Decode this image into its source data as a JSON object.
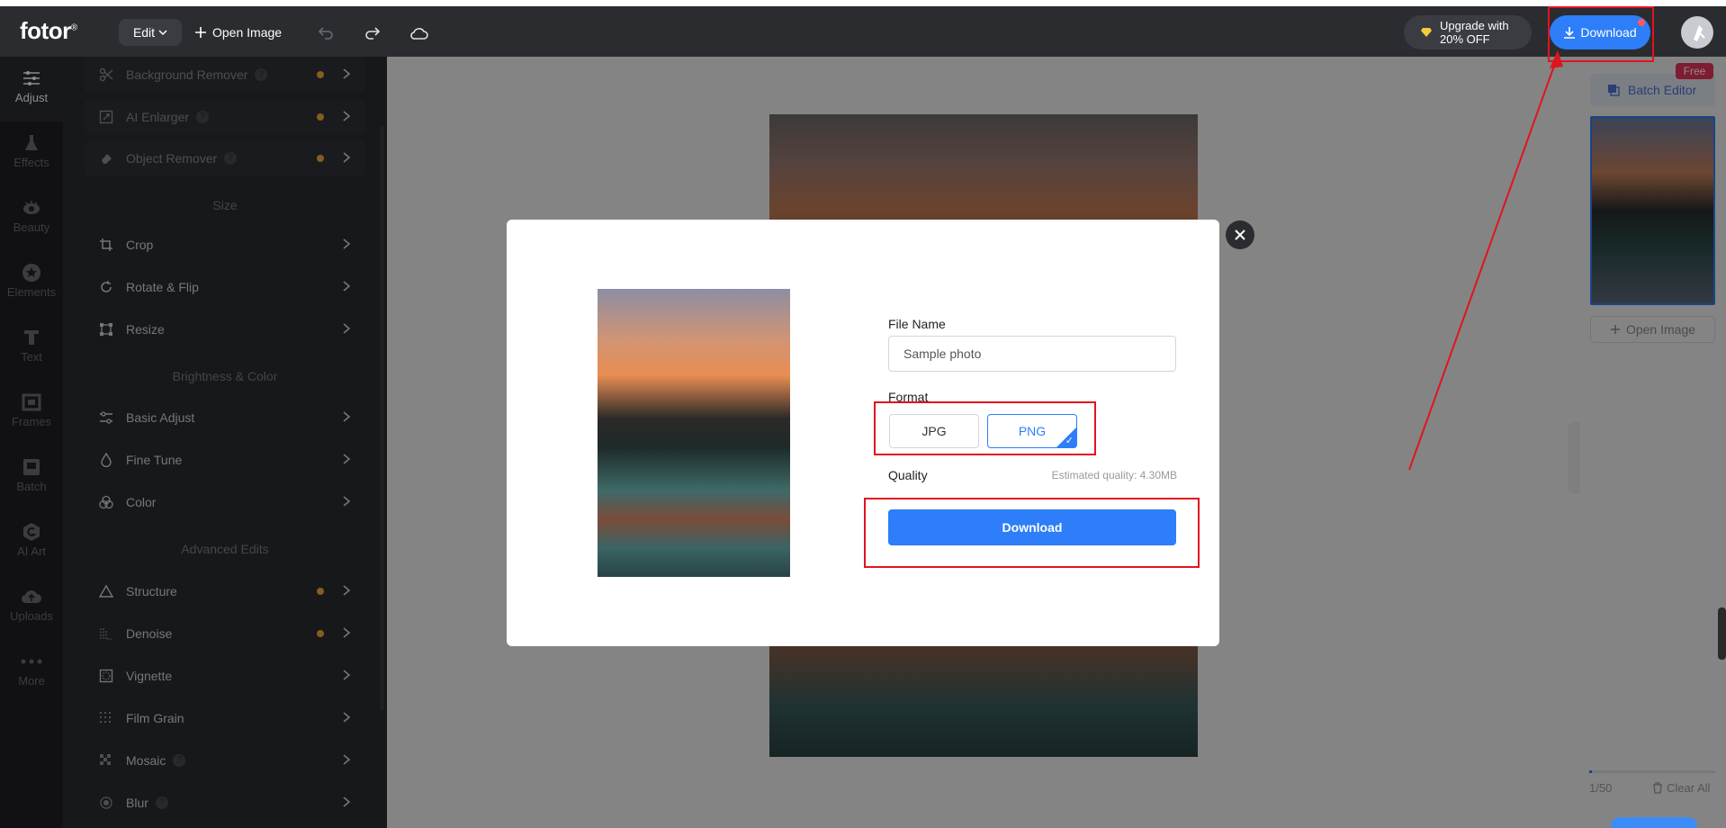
{
  "app": {
    "logo": "fotor",
    "logo_mark": "®"
  },
  "header": {
    "edit_label": "Edit",
    "open_image_label": "Open Image",
    "upgrade_line1": "Upgrade with",
    "upgrade_line2": "20% OFF",
    "download_label": "Download"
  },
  "leftnav": {
    "items": [
      {
        "label": "Adjust",
        "icon": "sliders-icon"
      },
      {
        "label": "Effects",
        "icon": "flask-icon"
      },
      {
        "label": "Beauty",
        "icon": "eye-icon"
      },
      {
        "label": "Elements",
        "icon": "star-circle-icon"
      },
      {
        "label": "Text",
        "icon": "text-icon"
      },
      {
        "label": "Frames",
        "icon": "frame-icon"
      },
      {
        "label": "Batch",
        "icon": "batch-icon"
      },
      {
        "label": "AI Art",
        "icon": "ai-art-icon"
      },
      {
        "label": "Uploads",
        "icon": "cloud-upload-icon"
      },
      {
        "label": "More",
        "icon": "more-icon"
      }
    ]
  },
  "panel": {
    "ai_tools": [
      {
        "label": "Background Remover",
        "help": "?"
      },
      {
        "label": "AI Enlarger",
        "help": "?"
      },
      {
        "label": "Object Remover",
        "help": "?"
      }
    ],
    "size_title": "Size",
    "size_tools": [
      {
        "label": "Crop"
      },
      {
        "label": "Rotate & Flip"
      },
      {
        "label": "Resize"
      }
    ],
    "brightness_title": "Brightness & Color",
    "brightness_tools": [
      {
        "label": "Basic Adjust"
      },
      {
        "label": "Fine Tune"
      },
      {
        "label": "Color"
      }
    ],
    "advanced_title": "Advanced Edits",
    "advanced_tools": [
      {
        "label": "Structure"
      },
      {
        "label": "Denoise"
      },
      {
        "label": "Vignette"
      },
      {
        "label": "Film Grain"
      },
      {
        "label": "Mosaic",
        "help": "?"
      },
      {
        "label": "Blur",
        "help": "?"
      }
    ]
  },
  "right_panel": {
    "free_tag": "Free",
    "batch_editor_label": "Batch Editor",
    "open_image_label": "Open Image",
    "counter": "1/50",
    "progress_fraction": 0.02,
    "clear_all_label": "Clear All"
  },
  "modal": {
    "file_name_label": "File Name",
    "file_name_value": "Sample photo",
    "format_label": "Format",
    "formats": [
      "JPG",
      "PNG"
    ],
    "selected_format": "PNG",
    "quality_label": "Quality",
    "estimated_quality": "Estimated quality: 4.30MB",
    "download_label": "Download"
  },
  "colors": {
    "accent": "#2d7ef8",
    "annotation_red": "#e0141e",
    "premium_dot": "#f3a93c",
    "free_tag": "#e8335b"
  }
}
